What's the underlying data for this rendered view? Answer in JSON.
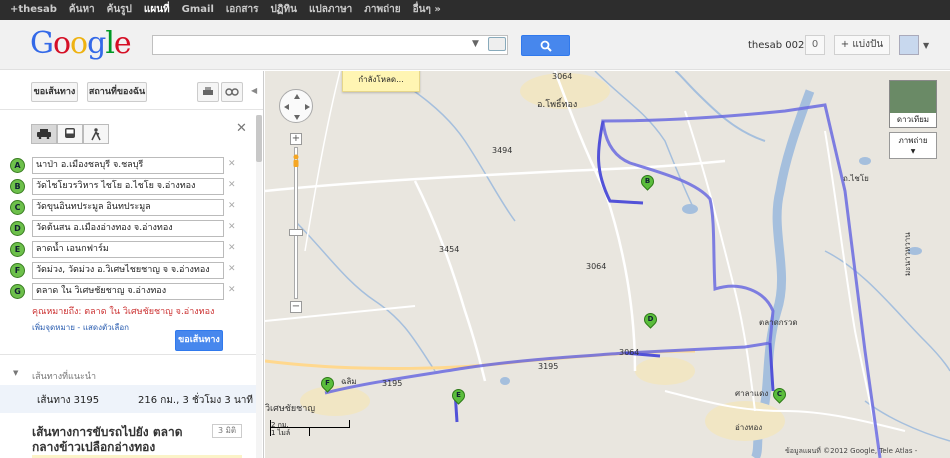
{
  "topbar": {
    "items": [
      "+thesab",
      "ค้นหา",
      "ค้นรูป",
      "แผนที่",
      "Gmail",
      "เอกสาร",
      "ปฏิทิน",
      "แปลภาษา",
      "ภาพถ่าย",
      "อื่นๆ »"
    ],
    "active_index": 3
  },
  "header": {
    "logo": "Google",
    "search_value": "",
    "user": "thesab 002",
    "notifications": "0",
    "share": "+ แบ่งปัน"
  },
  "sidebar": {
    "get_directions_tab": "ขอเส้นทาง",
    "my_places_tab": "สถานที่ของฉัน",
    "waypoints": [
      {
        "marker": "A",
        "value": "นาป่า อ.เมืองชลบุรี จ.ชลบุรี"
      },
      {
        "marker": "B",
        "value": "วัดไชโยวรวิหาร ไชโย อ.ไชโย จ.อ่างทอง"
      },
      {
        "marker": "C",
        "value": "วัดขุนอินทประมูล อินทประมูล"
      },
      {
        "marker": "D",
        "value": "วัดต้นสน อ.เมืองอ่างทอง จ.อ่างทอง"
      },
      {
        "marker": "E",
        "value": "ลาดน้ำ เอนกฟาร์ม"
      },
      {
        "marker": "F",
        "value": "วัดม่วง, วัดม่วง อ.วิเศษไชยชาญ จ จ.อ่างทอง"
      },
      {
        "marker": "G",
        "value": "ตลาด ใน วิเศษชัยชาญ จ.อ่างทอง"
      }
    ],
    "destination_note": "คุณหมายถึง: ตลาด ใน วิเศษชัยชาญ จ.อ่างทอง",
    "add_links": "เพิ่มจุดหมาย - แสดงตัวเลือก",
    "get_directions_button": "ขอเส้นทาง",
    "suggested_title": "เส้นทางที่แนะนำ",
    "route": {
      "name": "เส้นทาง 3195",
      "stats": "216 กม., 3 ชั่วโมง 3 นาที"
    },
    "description_title": "เส้นทางการขับรถไปยัง ตลาดกลางข้าวเปลือกอ่างทอง",
    "description_badge": "3 มิติ"
  },
  "map": {
    "loading": "กำลังโหลด...",
    "labels": [
      {
        "text": "อ.โพธิ์ทอง"
      },
      {
        "text": "3064"
      },
      {
        "text": "3494"
      },
      {
        "text": "ถ.ไชโย"
      },
      {
        "text": "3454"
      },
      {
        "text": "3064"
      },
      {
        "text": "ตลาดกรวด"
      },
      {
        "text": "3064"
      },
      {
        "text": "3195"
      },
      {
        "text": "3195"
      },
      {
        "text": "ศาลาแดง"
      },
      {
        "text": "อ่างทอง"
      },
      {
        "text": "วิเศษชัยชาญ"
      },
      {
        "text": "มะนาวหวาน"
      },
      {
        "text": "ฉลิม"
      }
    ],
    "pins": [
      "B",
      "D",
      "F",
      "E",
      "C"
    ],
    "satellite": "ดาวเทียม",
    "photos": "ภาพถ่าย",
    "scale_km": "2 กม.",
    "scale_mi": "1 ไมล์",
    "attribution": "ข้อมูลแผนที่ ©2012 Google, Tele Atlas -"
  },
  "colors": {
    "route": "#6a6ae0",
    "water": "#a5bfdd",
    "accent": "#4787ed"
  }
}
